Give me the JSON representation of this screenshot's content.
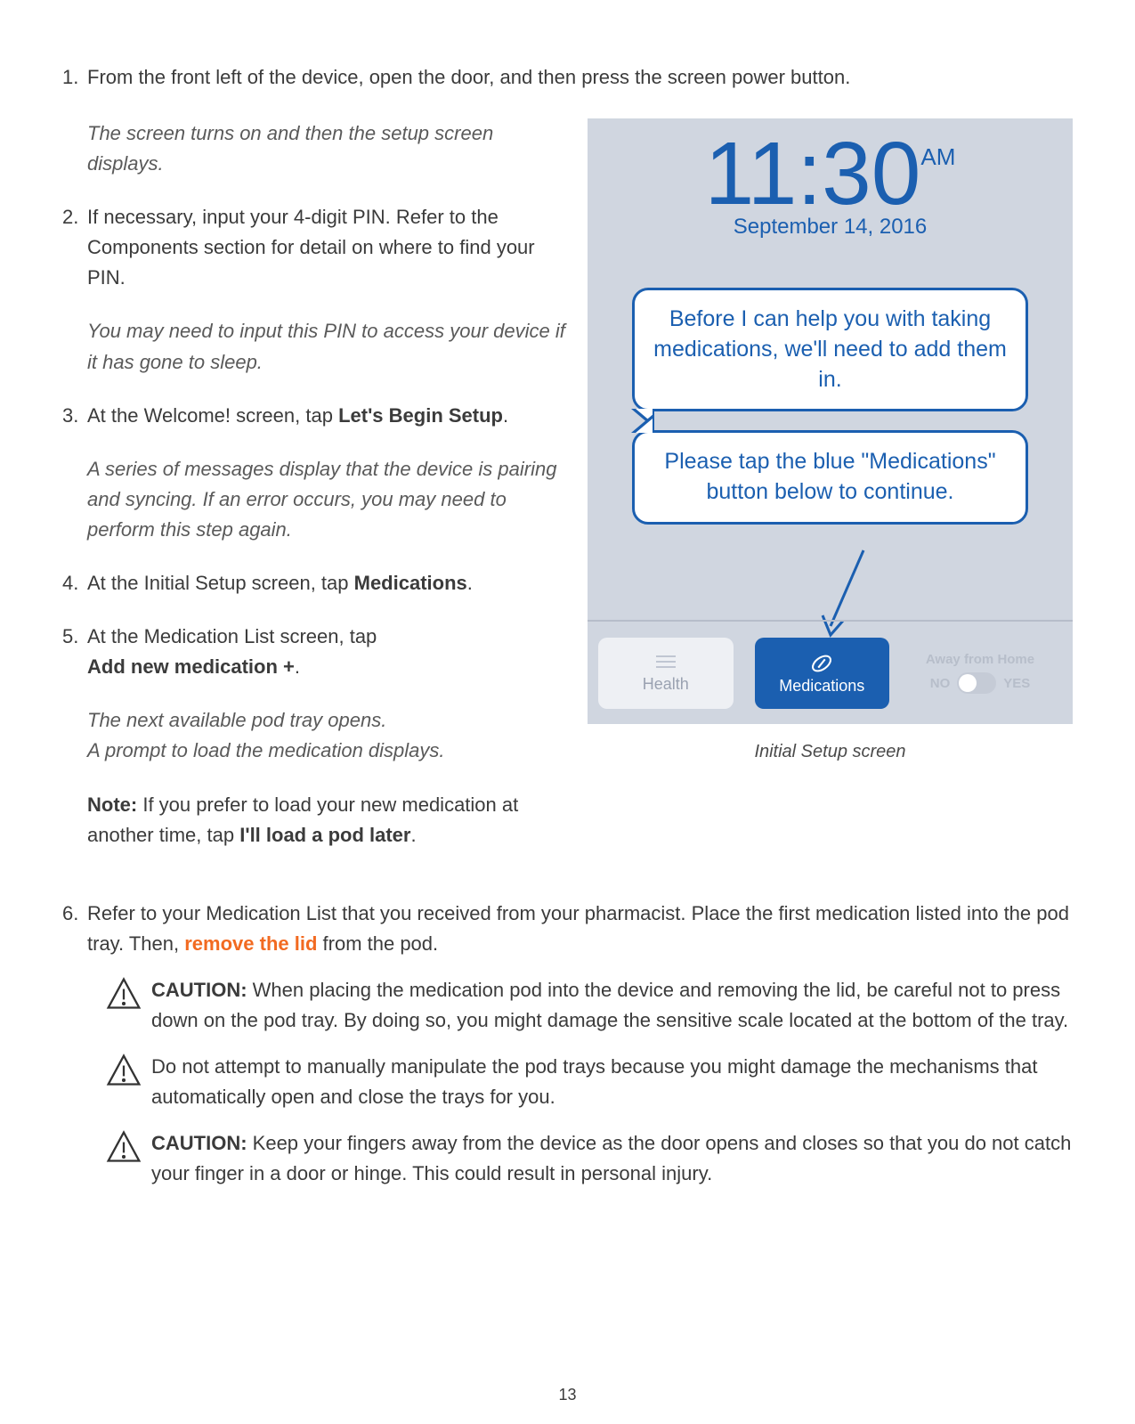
{
  "step1": {
    "num": "1.",
    "text": "From the front left of the device, open the door, and then press the screen power button.",
    "note": "The screen turns on and then the setup screen displays."
  },
  "step2": {
    "num": "2.",
    "text": "If necessary, input your 4-digit PIN.  Refer to the Components section for detail on where to find your PIN.",
    "note": "You may need to input this PIN to access your device if it has gone to sleep."
  },
  "step3": {
    "num": "3.",
    "text_pre": "At the Welcome! screen, tap ",
    "text_bold": "Let's Begin Setup",
    "text_post": ".",
    "note": "A series of messages display that the device is pairing and syncing.  If an error occurs, you may need to perform this step again."
  },
  "step4": {
    "num": "4.",
    "text_pre": "At the Initial Setup screen, tap ",
    "text_bold": "Medications",
    "text_post": "."
  },
  "step5": {
    "num": "5.",
    "line1": "At the Medication List screen, tap",
    "line2_bold": "Add new medication +",
    "line2_post": ".",
    "note": "The next available pod tray opens.\nA prompt to load the medication displays.",
    "note2_pre": "Note:",
    "note2_body": " If you prefer to load your new medication at another time, tap ",
    "note2_bold": "I'll load a pod later",
    "note2_post": "."
  },
  "step6": {
    "num": "6.",
    "text_pre": "Refer to your Medication List that you received from your pharmacist.  Place the first medication listed into the pod tray. Then, ",
    "highlight": "remove the lid",
    "text_post": " from the pod."
  },
  "caution1": {
    "label": "CAUTION:",
    "body": " When placing the medication pod into the device and removing the lid, be careful not to press down on the pod tray. By doing so, you might damage the sensitive scale located at the bottom of the tray."
  },
  "caution2": {
    "body": "Do not attempt to manually manipulate the pod trays because you might damage the mechanisms that automatically open and close the trays for you."
  },
  "caution3": {
    "label": "CAUTION:",
    "body": " Keep your fingers away from the device as the door opens and closes so that you do not catch your finger in a door or hinge.  This could result in personal injury."
  },
  "device": {
    "time": "11:30",
    "ampm": "AM",
    "date": "September 14, 2016",
    "bubble1": "Before I can help you with taking medications, we'll need to add them in.",
    "bubble2": "Please tap the blue \"Medications\" button below to continue.",
    "btn_health": "Health",
    "btn_meds": "Medications",
    "away_label": "Away from Home",
    "toggle_no": "NO",
    "toggle_yes": "YES"
  },
  "caption": "Initial Setup screen",
  "page_number": "13"
}
